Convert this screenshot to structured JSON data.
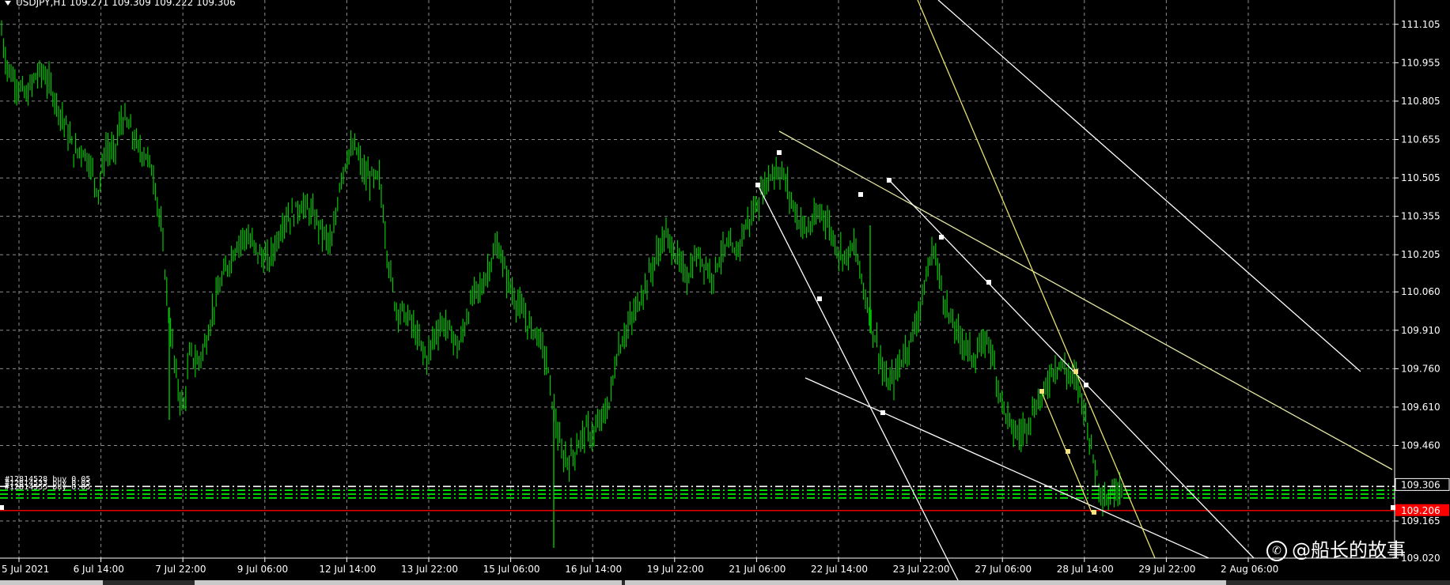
{
  "window": {
    "symbol_header": "USDJPY,H1  109.271 109.309 109.222 109.306"
  },
  "chart_data": {
    "type": "candlestick",
    "symbol": "USDJPY",
    "timeframe": "H1",
    "ohlc_header": {
      "open": 109.271,
      "high": 109.309,
      "low": 109.222,
      "close": 109.306
    },
    "y_ticks": [
      "111.105",
      "110.955",
      "110.805",
      "110.655",
      "110.505",
      "110.355",
      "110.205",
      "110.060",
      "109.910",
      "109.760",
      "109.610",
      "109.460",
      "109.306",
      "109.165",
      "109.020"
    ],
    "y_range": [
      109.02,
      111.2
    ],
    "x_ticks": [
      "5 Jul 2021",
      "6 Jul 14:00",
      "7 Jul 22:00",
      "9 Jul 06:00",
      "12 Jul 14:00",
      "13 Jul 22:00",
      "15 Jul 06:00",
      "16 Jul 14:00",
      "19 Jul 22:00",
      "21 Jul 06:00",
      "22 Jul 14:00",
      "23 Jul 22:00",
      "27 Jul 06:00",
      "28 Jul 14:00",
      "29 Jul 22:00",
      "2 Aug 06:00"
    ],
    "current_price": "109.306",
    "bid_line_price": "109.206",
    "price_path": [
      [
        0,
        111.12
      ],
      [
        8,
        110.95
      ],
      [
        16,
        110.9
      ],
      [
        24,
        110.86
      ],
      [
        34,
        110.82
      ],
      [
        44,
        110.9
      ],
      [
        54,
        110.92
      ],
      [
        64,
        110.86
      ],
      [
        74,
        110.78
      ],
      [
        84,
        110.7
      ],
      [
        94,
        110.6
      ],
      [
        104,
        110.62
      ],
      [
        114,
        110.56
      ],
      [
        124,
        110.45
      ],
      [
        134,
        110.62
      ],
      [
        144,
        110.6
      ],
      [
        154,
        110.74
      ],
      [
        164,
        110.7
      ],
      [
        174,
        110.62
      ],
      [
        184,
        110.6
      ],
      [
        194,
        110.52
      ],
      [
        204,
        110.3
      ],
      [
        214,
        109.95
      ],
      [
        224,
        109.7
      ],
      [
        232,
        109.6
      ],
      [
        240,
        109.82
      ],
      [
        250,
        109.78
      ],
      [
        260,
        109.86
      ],
      [
        270,
        110.0
      ],
      [
        280,
        110.1
      ],
      [
        290,
        110.18
      ],
      [
        300,
        110.25
      ],
      [
        310,
        110.28
      ],
      [
        320,
        110.24
      ],
      [
        330,
        110.2
      ],
      [
        340,
        110.18
      ],
      [
        350,
        110.26
      ],
      [
        360,
        110.35
      ],
      [
        370,
        110.36
      ],
      [
        380,
        110.4
      ],
      [
        390,
        110.38
      ],
      [
        400,
        110.34
      ],
      [
        410,
        110.28
      ],
      [
        420,
        110.24
      ],
      [
        430,
        110.5
      ],
      [
        440,
        110.6
      ],
      [
        450,
        110.62
      ],
      [
        460,
        110.52
      ],
      [
        470,
        110.5
      ],
      [
        480,
        110.5
      ],
      [
        490,
        110.2
      ],
      [
        500,
        110.0
      ],
      [
        510,
        109.98
      ],
      [
        520,
        109.94
      ],
      [
        530,
        109.86
      ],
      [
        540,
        109.8
      ],
      [
        550,
        109.9
      ],
      [
        560,
        109.94
      ],
      [
        570,
        109.9
      ],
      [
        580,
        109.84
      ],
      [
        590,
        109.96
      ],
      [
        600,
        110.06
      ],
      [
        610,
        110.08
      ],
      [
        620,
        110.18
      ],
      [
        630,
        110.24
      ],
      [
        640,
        110.12
      ],
      [
        650,
        110.04
      ],
      [
        660,
        109.98
      ],
      [
        670,
        109.92
      ],
      [
        680,
        109.9
      ],
      [
        690,
        109.8
      ],
      [
        700,
        109.6
      ],
      [
        710,
        109.42
      ],
      [
        720,
        109.4
      ],
      [
        730,
        109.46
      ],
      [
        740,
        109.52
      ],
      [
        750,
        109.5
      ],
      [
        760,
        109.56
      ],
      [
        770,
        109.62
      ],
      [
        780,
        109.82
      ],
      [
        790,
        109.9
      ],
      [
        800,
        109.96
      ],
      [
        810,
        110.04
      ],
      [
        820,
        110.12
      ],
      [
        830,
        110.2
      ],
      [
        840,
        110.28
      ],
      [
        850,
        110.24
      ],
      [
        860,
        110.16
      ],
      [
        870,
        110.12
      ],
      [
        880,
        110.2
      ],
      [
        890,
        110.18
      ],
      [
        900,
        110.12
      ],
      [
        910,
        110.2
      ],
      [
        920,
        110.24
      ],
      [
        930,
        110.2
      ],
      [
        940,
        110.3
      ],
      [
        950,
        110.36
      ],
      [
        960,
        110.42
      ],
      [
        970,
        110.5
      ],
      [
        980,
        110.54
      ],
      [
        990,
        110.52
      ],
      [
        1000,
        110.42
      ],
      [
        1010,
        110.34
      ],
      [
        1020,
        110.3
      ],
      [
        1030,
        110.34
      ],
      [
        1040,
        110.38
      ],
      [
        1050,
        110.3
      ],
      [
        1060,
        110.22
      ],
      [
        1070,
        110.2
      ],
      [
        1080,
        110.24
      ],
      [
        1090,
        110.1
      ],
      [
        1100,
        109.96
      ],
      [
        1110,
        109.84
      ],
      [
        1120,
        109.7
      ],
      [
        1130,
        109.72
      ],
      [
        1140,
        109.8
      ],
      [
        1150,
        109.86
      ],
      [
        1160,
        109.96
      ],
      [
        1170,
        110.1
      ],
      [
        1180,
        110.24
      ],
      [
        1190,
        110.08
      ],
      [
        1200,
        109.96
      ],
      [
        1210,
        109.9
      ],
      [
        1220,
        109.86
      ],
      [
        1230,
        109.8
      ],
      [
        1240,
        109.84
      ],
      [
        1250,
        109.88
      ],
      [
        1260,
        109.72
      ],
      [
        1270,
        109.6
      ],
      [
        1280,
        109.52
      ],
      [
        1290,
        109.5
      ],
      [
        1300,
        109.56
      ],
      [
        1310,
        109.62
      ],
      [
        1320,
        109.66
      ],
      [
        1330,
        109.76
      ],
      [
        1340,
        109.78
      ],
      [
        1350,
        109.74
      ],
      [
        1360,
        109.72
      ],
      [
        1370,
        109.62
      ],
      [
        1380,
        109.44
      ],
      [
        1390,
        109.3
      ],
      [
        1400,
        109.24
      ],
      [
        1410,
        109.3
      ],
      [
        1420,
        109.31
      ]
    ],
    "spikes": [
      [
        214,
        110.0,
        109.56
      ],
      [
        700,
        109.6,
        109.06
      ],
      [
        1100,
        110.32,
        109.9
      ]
    ]
  },
  "order_lines": [
    {
      "price": 109.3,
      "color": "#ffffff",
      "style": "dashdot",
      "label": "#12814528 buy 0.05"
    },
    {
      "price": 109.285,
      "color": "#00ff00",
      "style": "dashdot",
      "label": "#12814533 buy 0.05"
    },
    {
      "price": 109.27,
      "color": "#00ff00",
      "style": "dashdot",
      "label": "#12814555 buy 0.05"
    },
    {
      "price": 109.255,
      "color": "#00ff00",
      "style": "dashdot",
      "label": ""
    }
  ],
  "trendlines": [
    {
      "color": "#e6e6a0",
      "pts": [
        [
          985,
          166
        ],
        [
          1760,
          594
        ]
      ]
    },
    {
      "color": "#ffffff",
      "pts": [
        [
          958,
          234
        ],
        [
          1212,
          736
        ]
      ]
    },
    {
      "color": "#ffffff",
      "pts": [
        [
          1018,
          478
        ],
        [
          1528,
          706
        ]
      ]
    },
    {
      "color": "#ffffff",
      "pts": [
        [
          1125,
          229
        ],
        [
          1585,
          706
        ]
      ]
    },
    {
      "color": "#e8e070",
      "pts": [
        [
          1160,
          0
        ],
        [
          1460,
          706
        ]
      ]
    },
    {
      "color": "#e8e070",
      "pts": [
        [
          1316,
          494
        ],
        [
          1380,
          648
        ]
      ]
    },
    {
      "color": "#ffffff",
      "pts": [
        [
          1186,
          0
        ],
        [
          1720,
          470
        ]
      ]
    }
  ],
  "anchor_points": [
    {
      "color": "#ffffff",
      "pt": [
        985,
        193
      ]
    },
    {
      "color": "#ffffff",
      "pt": [
        958,
        234
      ]
    },
    {
      "color": "#ffffff",
      "pt": [
        1088,
        246
      ]
    },
    {
      "color": "#ffffff",
      "pt": [
        1124,
        228
      ]
    },
    {
      "color": "#ffffff",
      "pt": [
        1036,
        378
      ]
    },
    {
      "color": "#ffffff",
      "pt": [
        1190,
        300
      ]
    },
    {
      "color": "#ffffff",
      "pt": [
        1250,
        357
      ]
    },
    {
      "color": "#ffffff",
      "pt": [
        1116,
        522
      ]
    },
    {
      "color": "#ffffff",
      "pt": [
        1373,
        487
      ]
    },
    {
      "color": "#f5e27a",
      "pt": [
        1360,
        470
      ]
    },
    {
      "color": "#f5e27a",
      "pt": [
        1317,
        495
      ]
    },
    {
      "color": "#f5e27a",
      "pt": [
        1350,
        571
      ]
    },
    {
      "color": "#f5e27a",
      "pt": [
        1383,
        648
      ]
    },
    {
      "color": "#ffffff",
      "pt": [
        2,
        642
      ]
    },
    {
      "color": "#ffffff",
      "pt": [
        1761,
        642
      ]
    }
  ],
  "watermark": {
    "icon": "weibo-icon",
    "text": "@船长的故事"
  },
  "colors": {
    "background": "#000000",
    "candles": "#00c800",
    "grid": "#8a8a8a",
    "axis_text": "#ffffff",
    "bid_line": "#ff0000",
    "price_tag_bg": "#ff0000"
  }
}
